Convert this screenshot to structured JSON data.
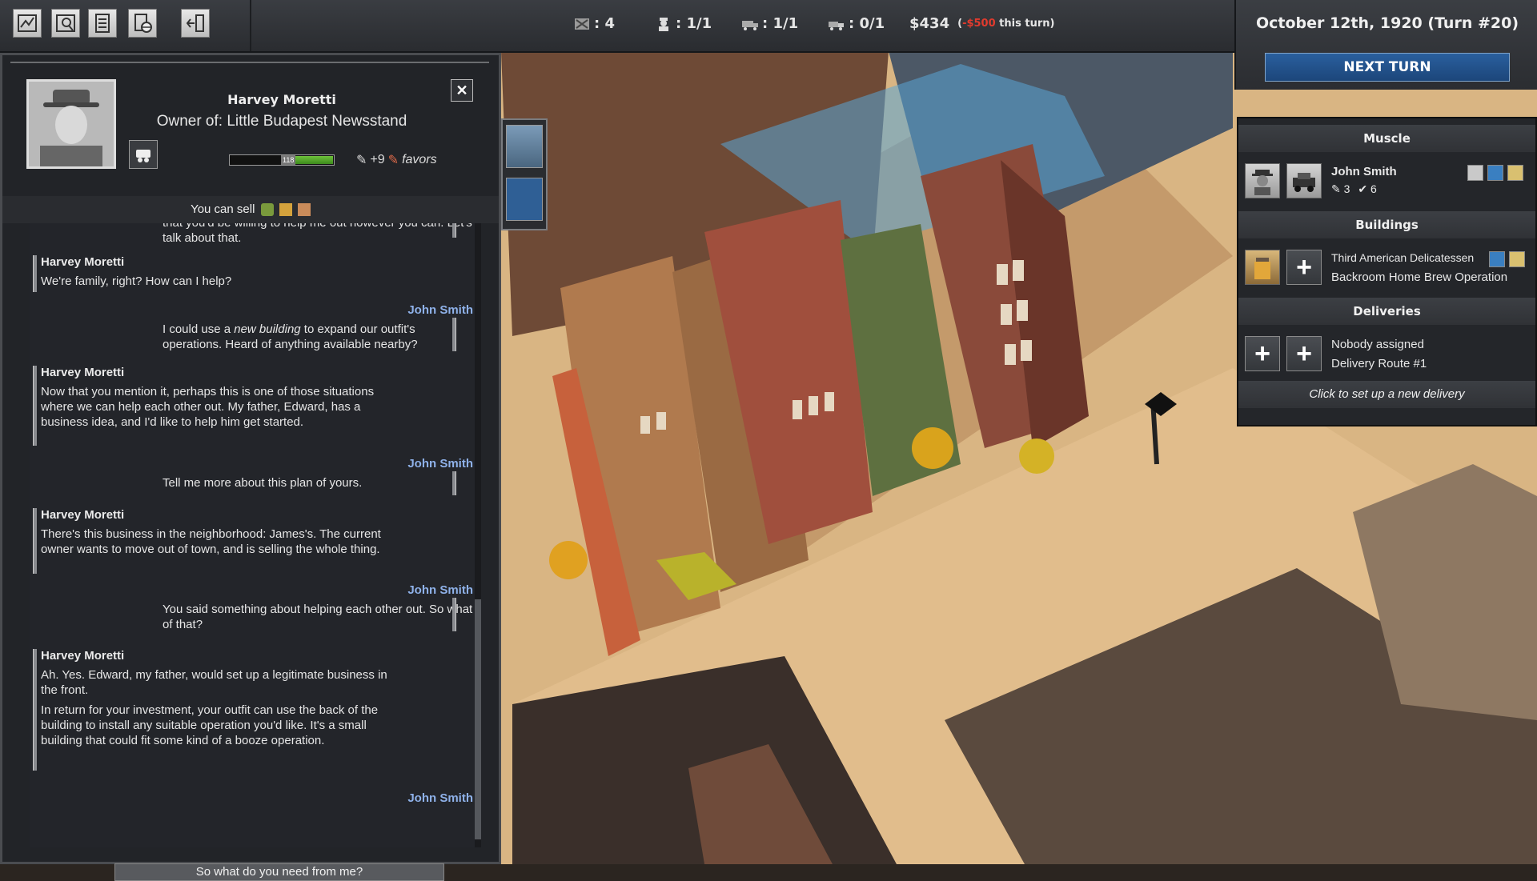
{
  "topbar": {
    "buttons": [
      {
        "icon": "city-map-icon"
      },
      {
        "icon": "map-search-icon"
      },
      {
        "icon": "ledger-icon"
      },
      {
        "icon": "document-globe-icon"
      },
      {
        "icon": "exit-icon"
      }
    ],
    "stats": [
      {
        "icon": "territory-flag-icon",
        "value": ": 4"
      },
      {
        "icon": "gangster-icon",
        "value": ": 1/1"
      },
      {
        "icon": "truck-icon",
        "value": ": 1/1"
      },
      {
        "icon": "delivery-truck-icon",
        "value": ": 0/1"
      }
    ],
    "money": "$434",
    "money_note_open": "(",
    "money_note_delta": "-$500",
    "money_note_close": " this turn)"
  },
  "turn": {
    "date": "October 12th, 1920  (Turn #20)",
    "next_turn_label": "NEXT TURN"
  },
  "right_panel": {
    "muscle_title": "Muscle",
    "muscle_name": "John Smith",
    "muscle_stat1": "3",
    "muscle_stat2": "6",
    "buildings_title": "Buildings",
    "building_name": "Third American Delicatessen",
    "building_operation": "Backroom Home Brew Operation",
    "deliveries_title": "Deliveries",
    "delivery_assignee": "Nobody assigned",
    "delivery_route": "Delivery Route #1",
    "new_delivery_hint": "Click to set up a new delivery"
  },
  "dialog": {
    "npc_name": "Harvey Moretti",
    "npc_owner": "Owner of: Little Budapest Newsstand",
    "relationship_value": "118",
    "relationship_level": 0.55,
    "favors_count": "+9",
    "favors_label": "favors",
    "sell_label": "You can sell",
    "close_label": "✕",
    "reply_option": "So what do you need from me?",
    "messages": [
      {
        "speaker": "",
        "text": "that you'd be willing to help me out however you can. Let's talk about that."
      },
      {
        "speaker": "Harvey Moretti",
        "text": "We're family, right? How can I help?"
      },
      {
        "speaker": "John Smith",
        "text_a": "I could use a ",
        "text_em": "new building",
        "text_b": " to expand our outfit's operations. Heard of anything available nearby?"
      },
      {
        "speaker": "Harvey Moretti",
        "text": "Now that you mention it, perhaps this is one of those situations where we can help each other out. My father, Edward, has a business idea, and I'd like to help him get started."
      },
      {
        "speaker": "John Smith",
        "text": "Tell me more about this plan of yours."
      },
      {
        "speaker": "Harvey Moretti",
        "text": "There's this business in the neighborhood: James's. The current owner wants to move out of town, and is selling the whole thing."
      },
      {
        "speaker": "John Smith",
        "text": "You said something about helping each other out. So what of that?"
      },
      {
        "speaker": "Harvey Moretti",
        "text": "Ah. Yes. Edward, my father, would set up a legitimate business in the front.",
        "text2": "In return for your investment, your outfit can use the back of the building to install any suitable operation you'd like. It's a small building that could fit some kind of a booze operation."
      },
      {
        "speaker": "John Smith",
        "text": ""
      }
    ]
  }
}
